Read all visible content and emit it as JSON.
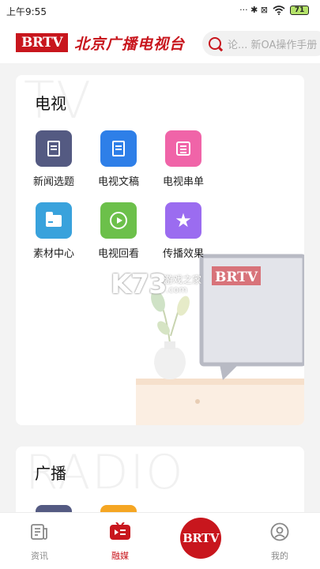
{
  "status_bar": {
    "time": "上午9:55",
    "indicators": "··· ✱ ⊠",
    "battery": "71",
    "icons": [
      "dots-icon",
      "bluetooth-icon",
      "signal-icon",
      "wifi-icon",
      "battery-icon"
    ]
  },
  "header": {
    "logo_text": "BRTV",
    "station_name": "北京广播电视台",
    "search_placeholder": "论... 新OA操作手册",
    "brand_color": "#c8161d"
  },
  "sections": [
    {
      "title": "电视",
      "background_word": "TV",
      "items": [
        {
          "label": "新闻选题",
          "icon": "news-topic-icon",
          "color": "#545a82"
        },
        {
          "label": "电视文稿",
          "icon": "tv-script-icon",
          "color": "#2e7fe8"
        },
        {
          "label": "电视串单",
          "icon": "tv-rundown-icon",
          "color": "#f064a8"
        },
        {
          "label": "素材中心",
          "icon": "material-folder-icon",
          "color": "#39a2dc"
        },
        {
          "label": "电视回看",
          "icon": "tv-replay-icon",
          "color": "#6cc04a"
        },
        {
          "label": "传播效果",
          "icon": "star-effect-icon",
          "color": "#9b6cf0"
        }
      ],
      "illustration_logo": "BRTV"
    },
    {
      "title": "广播",
      "background_word": "RADIO",
      "items": [
        {
          "icon": "radio-item-icon",
          "color": "#545a82"
        },
        {
          "icon": "radio-item-icon",
          "color": "#f5a623"
        }
      ]
    }
  ],
  "tab_bar": {
    "tabs": [
      {
        "label": "资讯",
        "icon": "news-tab-icon",
        "active": false
      },
      {
        "label": "融媒",
        "icon": "media-tab-icon",
        "active": true
      },
      {
        "label": "BRTV",
        "icon": "brtv-center-icon",
        "active": false
      },
      {
        "label": "我的",
        "icon": "profile-tab-icon",
        "active": false
      }
    ]
  },
  "watermark": {
    "main": "K73",
    "sub": "游戏之家",
    "domain": ".com"
  }
}
